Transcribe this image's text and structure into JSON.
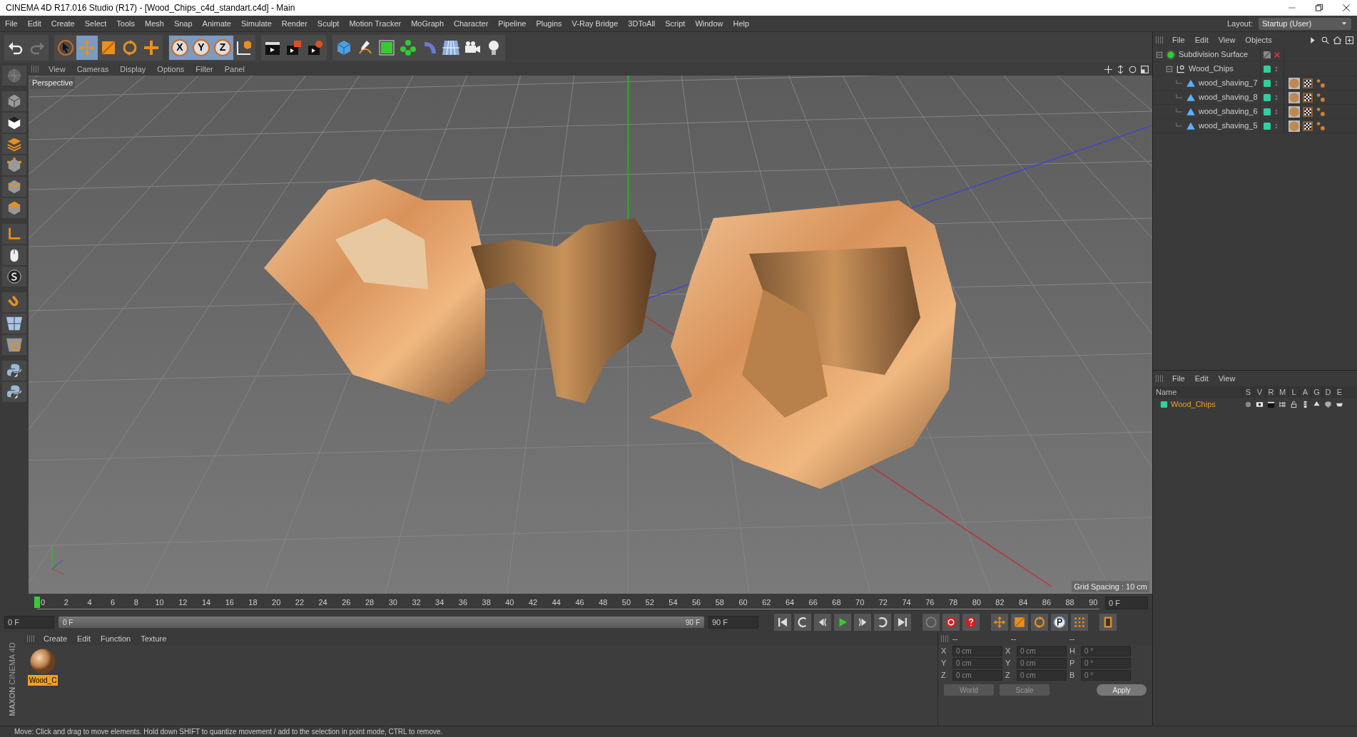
{
  "window": {
    "title": "CINEMA 4D R17.016 Studio (R17) - [Wood_Chips_c4d_standart.c4d] - Main"
  },
  "menu": [
    "File",
    "Edit",
    "Create",
    "Select",
    "Tools",
    "Mesh",
    "Snap",
    "Animate",
    "Simulate",
    "Render",
    "Sculpt",
    "Motion Tracker",
    "MoGraph",
    "Character",
    "Pipeline",
    "Plugins",
    "V-Ray Bridge",
    "3DToAll",
    "Script",
    "Window",
    "Help"
  ],
  "layout": {
    "label": "Layout:",
    "value": "Startup (User)"
  },
  "toolbar": [
    [
      {
        "kind": "undo",
        "selected": false
      },
      {
        "kind": "redo",
        "selected": false
      }
    ],
    [
      {
        "kind": "select",
        "selected": false
      },
      {
        "kind": "move",
        "selected": true
      },
      {
        "kind": "scale",
        "selected": false
      },
      {
        "kind": "rotate",
        "selected": false
      },
      {
        "kind": "add",
        "selected": false
      }
    ],
    [
      {
        "kind": "axis",
        "label": "X",
        "selected": true
      },
      {
        "kind": "axis",
        "label": "Y",
        "selected": true
      },
      {
        "kind": "axis",
        "label": "Z",
        "selected": true
      },
      {
        "kind": "coord",
        "selected": false
      }
    ],
    [
      {
        "kind": "render_view",
        "selected": false
      },
      {
        "kind": "render_picture",
        "selected": false
      },
      {
        "kind": "render_settings",
        "selected": false
      }
    ],
    [
      {
        "kind": "cube",
        "selected": false
      },
      {
        "kind": "pen",
        "selected": false
      },
      {
        "kind": "subdiv",
        "selected": false
      },
      {
        "kind": "cloner",
        "selected": false
      },
      {
        "kind": "deformer",
        "selected": false
      },
      {
        "kind": "floor",
        "selected": false
      },
      {
        "kind": "camera",
        "selected": false
      },
      {
        "kind": "light",
        "selected": false
      }
    ]
  ],
  "side_tools": [
    {
      "kind": "editable"
    },
    {
      "kind": "model"
    },
    {
      "kind": "texture"
    },
    {
      "kind": "layers"
    },
    {
      "kind": "points"
    },
    {
      "kind": "edges"
    },
    {
      "kind": "polygons"
    },
    {
      "kind": "axis_mode"
    },
    {
      "kind": "tweak"
    },
    {
      "kind": "snap"
    },
    {
      "kind": "magnet"
    },
    {
      "kind": "workplane"
    },
    {
      "kind": "gridlock"
    },
    {
      "kind": "python"
    },
    {
      "kind": "python"
    }
  ],
  "viewport": {
    "menu": [
      "View",
      "Cameras",
      "Display",
      "Options",
      "Filter",
      "Panel"
    ],
    "camera": "Perspective",
    "grid_spacing": "Grid Spacing : 10 cm"
  },
  "timeline": {
    "ticks": [
      "0",
      "2",
      "4",
      "6",
      "8",
      "10",
      "12",
      "14",
      "16",
      "18",
      "20",
      "22",
      "24",
      "26",
      "28",
      "30",
      "32",
      "34",
      "36",
      "38",
      "40",
      "42",
      "44",
      "46",
      "48",
      "50",
      "52",
      "54",
      "56",
      "58",
      "60",
      "62",
      "64",
      "66",
      "68",
      "70",
      "72",
      "74",
      "76",
      "78",
      "80",
      "82",
      "84",
      "86",
      "88",
      "90"
    ],
    "frame": "0 F",
    "start": "0 F",
    "range": {
      "start": "0 F",
      "end": "90 F",
      "level": 1
    },
    "end": "90 F",
    "controls": [
      {
        "kind": "first"
      },
      {
        "kind": "prev_key"
      },
      {
        "kind": "prev_frame"
      },
      {
        "kind": "play"
      },
      {
        "kind": "next_frame"
      },
      {
        "kind": "next_key"
      },
      {
        "kind": "last"
      },
      {
        "kind": "record_off"
      },
      {
        "kind": "record"
      },
      {
        "kind": "help"
      },
      {
        "kind": "move"
      },
      {
        "kind": "scale"
      },
      {
        "kind": "rotate"
      },
      {
        "kind": "param"
      },
      {
        "kind": "pla"
      },
      {
        "kind": "film"
      }
    ]
  },
  "materials": {
    "menu": [
      "Create",
      "Edit",
      "Function",
      "Texture"
    ],
    "items": [
      {
        "name": "Wood_C",
        "selected": true
      }
    ]
  },
  "brand": [
    "MAXON",
    "CINEMA 4D"
  ],
  "coordinates": {
    "headers": [
      "--",
      "--",
      "--"
    ],
    "rows": [
      [
        {
          "axis": "X",
          "value": "0 cm"
        },
        {
          "axis": "X",
          "value": "0 cm"
        },
        {
          "axis": "H",
          "value": "0 °"
        }
      ],
      [
        {
          "axis": "Y",
          "value": "0 cm"
        },
        {
          "axis": "Y",
          "value": "0 cm"
        },
        {
          "axis": "P",
          "value": "0 °"
        }
      ],
      [
        {
          "axis": "Z",
          "value": "0 cm"
        },
        {
          "axis": "Z",
          "value": "0 cm"
        },
        {
          "axis": "B",
          "value": "0 °"
        }
      ]
    ],
    "mode": "World",
    "transform": "Scale",
    "apply": "Apply"
  },
  "objects": {
    "menu": [
      "File",
      "Edit",
      "View",
      "Objects"
    ],
    "tree": [
      {
        "name": "Subdivision Surface",
        "kind": "subdivision",
        "children": [
          {
            "name": "Wood_Chips",
            "kind": "null",
            "children": [
              {
                "name": "wood_shaving_7",
                "kind": "polygon"
              },
              {
                "name": "wood_shaving_8",
                "kind": "polygon"
              },
              {
                "name": "wood_shaving_6",
                "kind": "polygon"
              },
              {
                "name": "wood_shaving_5",
                "kind": "polygon"
              }
            ]
          }
        ]
      }
    ]
  },
  "attributes": {
    "menu": [
      "File",
      "Edit",
      "View"
    ],
    "columns": [
      "Name",
      "S",
      "V",
      "R",
      "M",
      "L",
      "A",
      "G",
      "D",
      "E"
    ],
    "rows": [
      {
        "name": "Wood_Chips",
        "selected": true
      }
    ]
  },
  "status_bar": "Move: Click and drag to move elements. Hold down SHIFT to quantize movement / add to the selection in point mode, CTRL to remove."
}
